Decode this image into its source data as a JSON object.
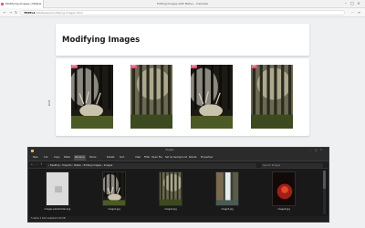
{
  "browser": {
    "tab_title": "Modifying Images | Matsu",
    "window_title": "Editing Images with Matsu – Cascade",
    "tab_close": "×",
    "url_host": "TEXEL4",
    "url_path": "/databases/modifying-images.html"
  },
  "page": {
    "title": "Modifying Images",
    "badge_label": "JPG",
    "photos": [
      {
        "variant": "deer"
      },
      {
        "variant": "forest"
      },
      {
        "variant": "deer"
      },
      {
        "variant": "forest"
      }
    ]
  },
  "explorer": {
    "title": "Images",
    "ribbon": [
      "New",
      "Cut",
      "Copy",
      "Paste",
      "Rename",
      "Share",
      "Delete",
      "Sort",
      "View",
      "Filter",
      "Open file",
      "Set as background",
      "Rotate",
      "Properties"
    ],
    "active_ribbon_index": 4,
    "breadcrumb": "› Desktop › Projects › Matsu › Editing Images › Images",
    "search_placeholder": "Search Images",
    "files": [
      {
        "name": "images-placeholder.png",
        "kind": "placeholder"
      },
      {
        "name": "image1.jpg",
        "kind": "deer"
      },
      {
        "name": "image2.jpg",
        "kind": "forest"
      },
      {
        "name": "image3.jpg",
        "kind": "waterfall"
      },
      {
        "name": "image4.jpg",
        "kind": "red"
      }
    ],
    "status": "5 items   1 item selected 142 KB"
  },
  "colors": {
    "accent": "#e94e77",
    "explorer_bg": "#191919"
  }
}
